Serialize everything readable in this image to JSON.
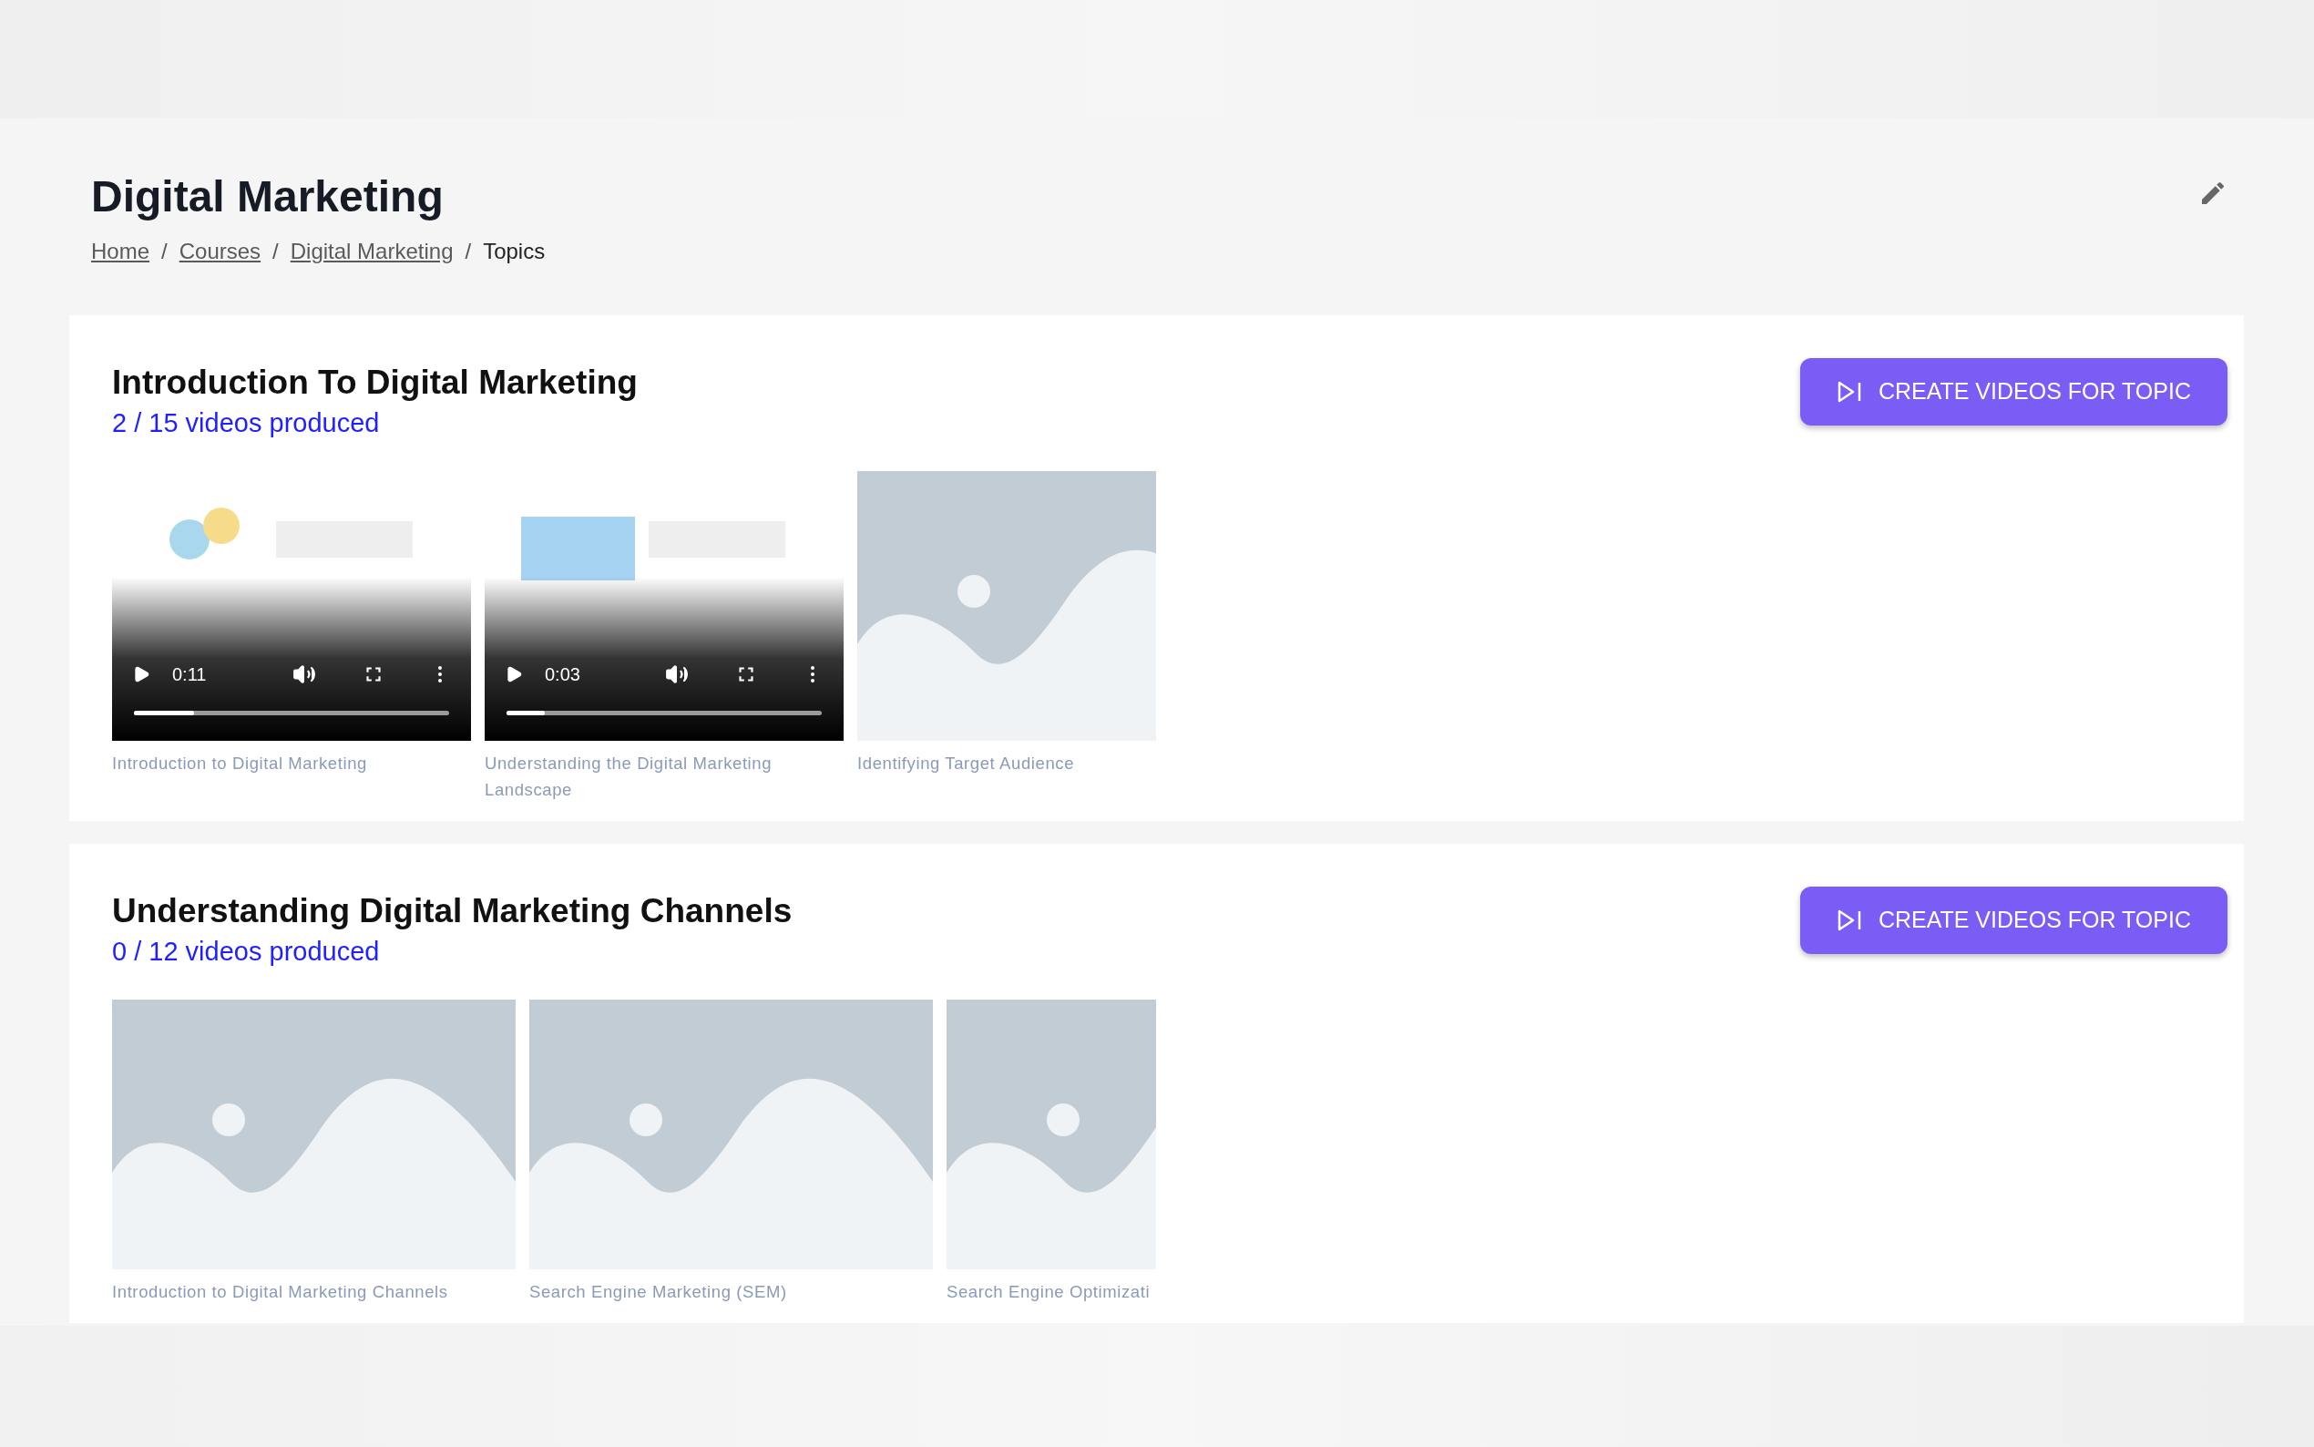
{
  "page": {
    "title": "Digital Marketing"
  },
  "breadcrumb": [
    {
      "label": "Home",
      "kind": "link"
    },
    {
      "separator": "/",
      "label": "Courses",
      "kind": "link"
    },
    {
      "separator": "/",
      "label": "Digital Marketing",
      "kind": "link"
    },
    {
      "separator": "/",
      "label": "Topics",
      "kind": "current"
    }
  ],
  "topics": [
    {
      "title": "Introduction To Digital Marketing",
      "progress": "2 / 15 videos produced",
      "button": "CREATE VIDEOS FOR TOPIC",
      "videos": [
        {
          "kind": "video",
          "caption": "Introduction to Digital Marketing",
          "time": "0:11",
          "level": 0.19
        },
        {
          "kind": "video",
          "caption": "Understanding the Digital Marketing Landscape",
          "time": "0:03",
          "level": 0.12
        },
        {
          "kind": "placeholder",
          "caption": "Identifying Target Audience"
        }
      ]
    },
    {
      "title": "Understanding Digital Marketing Channels",
      "progress": "0 / 12 videos produced",
      "button": "CREATE VIDEOS FOR TOPIC",
      "videos": [
        {
          "kind": "placeholder",
          "caption": "Introduction to Digital Marketing Channels"
        },
        {
          "kind": "placeholder",
          "caption": "Search Engine Marketing (SEM)"
        },
        {
          "kind": "placeholder",
          "caption": "Search Engine Optimizati"
        }
      ]
    }
  ]
}
